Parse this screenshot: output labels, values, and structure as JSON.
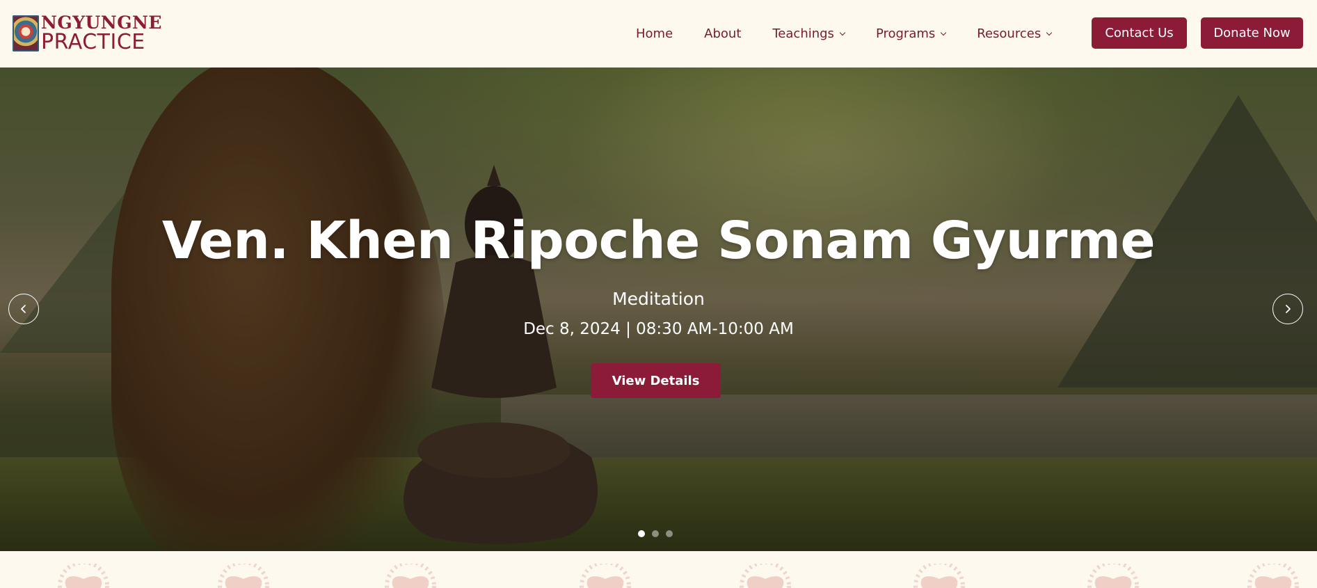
{
  "logo": {
    "line1": "NGYUNGNE",
    "line2": "PRACTICE"
  },
  "nav": {
    "items": [
      {
        "label": "Home",
        "dropdown": false
      },
      {
        "label": "About",
        "dropdown": false
      },
      {
        "label": "Teachings",
        "dropdown": true
      },
      {
        "label": "Programs",
        "dropdown": true
      },
      {
        "label": "Resources",
        "dropdown": true
      }
    ],
    "contact_label": "Contact Us",
    "donate_label": "Donate Now"
  },
  "hero": {
    "title": "Ven. Khen Ripoche Sonam Gyurme",
    "subtitle": "Meditation",
    "date": "Dec 8, 2024 | 08:30 AM-10:00 AM",
    "button_label": "View Details",
    "slide_count": 3,
    "active_slide": 1
  },
  "colors": {
    "brand": "#8c1b38",
    "nav_text": "#7a1a30",
    "background": "#fdf9ee"
  },
  "icons": {
    "prev": "chevron-left-icon",
    "next": "chevron-right-icon",
    "dropdown": "chevron-down-icon"
  }
}
